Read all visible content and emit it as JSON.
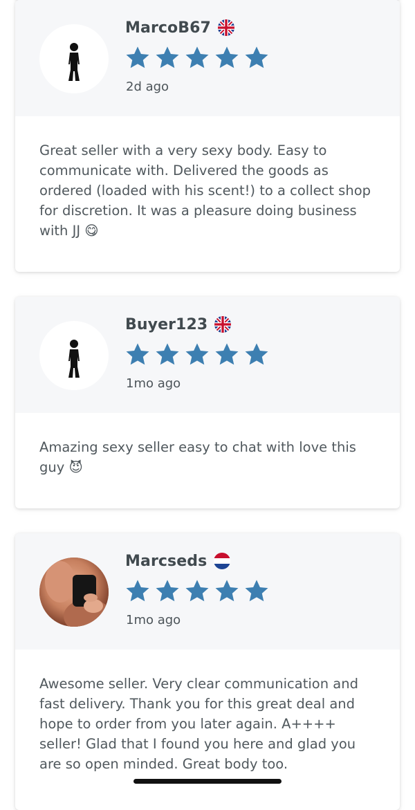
{
  "reviews": [
    {
      "name": "MarcoB67",
      "flag": "uk-flag-icon",
      "rating": 5,
      "time": "2d ago",
      "avatar": "person-silhouette-icon",
      "text": "Great seller with a very sexy body. Easy to communicate with. Delivered the goods as ordered (loaded with his scent!) to a collect shop for discretion. It was a pleasure doing business with JJ 😋"
    },
    {
      "name": "Buyer123",
      "flag": "uk-flag-icon",
      "rating": 5,
      "time": "1mo ago",
      "avatar": "person-silhouette-icon",
      "text": "Amazing sexy seller easy to chat with love this guy 😈"
    },
    {
      "name": "Marcseds",
      "flag": "netherlands-flag-icon",
      "rating": 5,
      "time": "1mo ago",
      "avatar": "profile-photo",
      "text": "Awesome seller. Very clear communication and fast delivery. Thank you for this great deal and hope to order from you later again. A++++ seller! Glad that I found you here and glad you are so open minded. Great body too."
    }
  ],
  "colors": {
    "star": "#3d7fb1",
    "card_header": "#f6f7f9",
    "name_text": "#414a4f",
    "body_text": "#50585d"
  }
}
